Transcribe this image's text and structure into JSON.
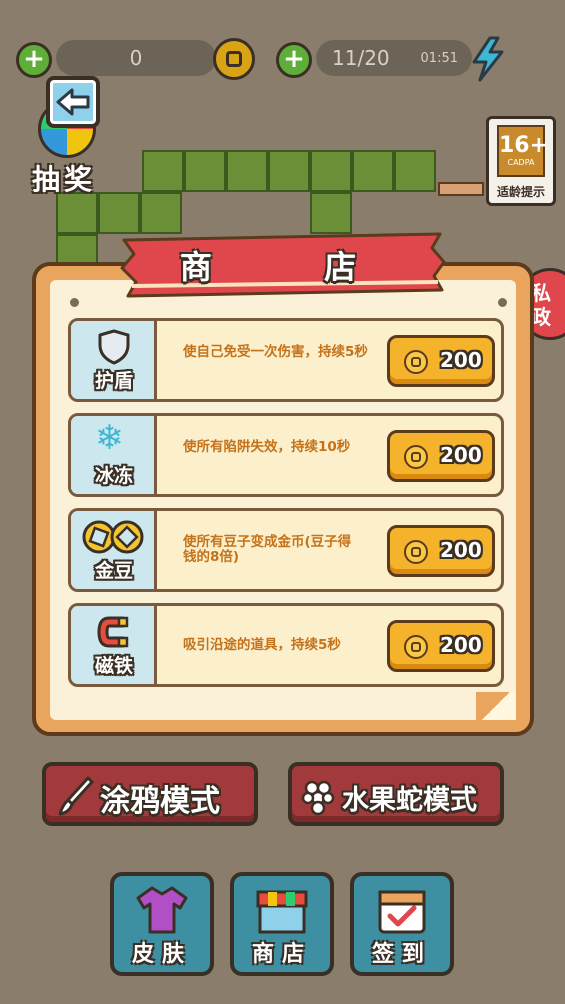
{
  "topbar": {
    "coins_value": "0",
    "energy_value": "11/20",
    "energy_timer": "01:51"
  },
  "lottery": {
    "label": "抽奖"
  },
  "age_rating": {
    "badge": "16+",
    "org": "CADPA",
    "label": "适龄提示"
  },
  "side_badge": {
    "label": "私 政"
  },
  "shop": {
    "title": "商  店",
    "items": [
      {
        "name": "护盾",
        "icon": "shield-icon",
        "desc": "使自己免受一次伤害，持续5秒",
        "price": "200"
      },
      {
        "name": "冰冻",
        "icon": "snowflake-icon",
        "desc": "使所有陷阱失效，持续10秒",
        "price": "200"
      },
      {
        "name": "金豆",
        "icon": "gold-beans-icon",
        "desc": "使所有豆子变成金币(豆子得钱的8倍)",
        "price": "200"
      },
      {
        "name": "磁铁",
        "icon": "magnet-icon",
        "desc": "吸引沿途的道具，持续5秒",
        "price": "200"
      }
    ]
  },
  "modes": {
    "doodle": "涂鸦模式",
    "fruit_snake": "水果蛇模式"
  },
  "bottom_nav": {
    "skin": "皮肤",
    "shop": "商店",
    "checkin": "签到"
  },
  "colors": {
    "background": "#8a7d6c",
    "panel": "#e9a55d",
    "ribbon": "#e0474c",
    "buy_button": "#f5b22b",
    "mode_button": "#a23a3c",
    "nav_button": "#3f8fa3",
    "snake": "#6a8f37"
  }
}
